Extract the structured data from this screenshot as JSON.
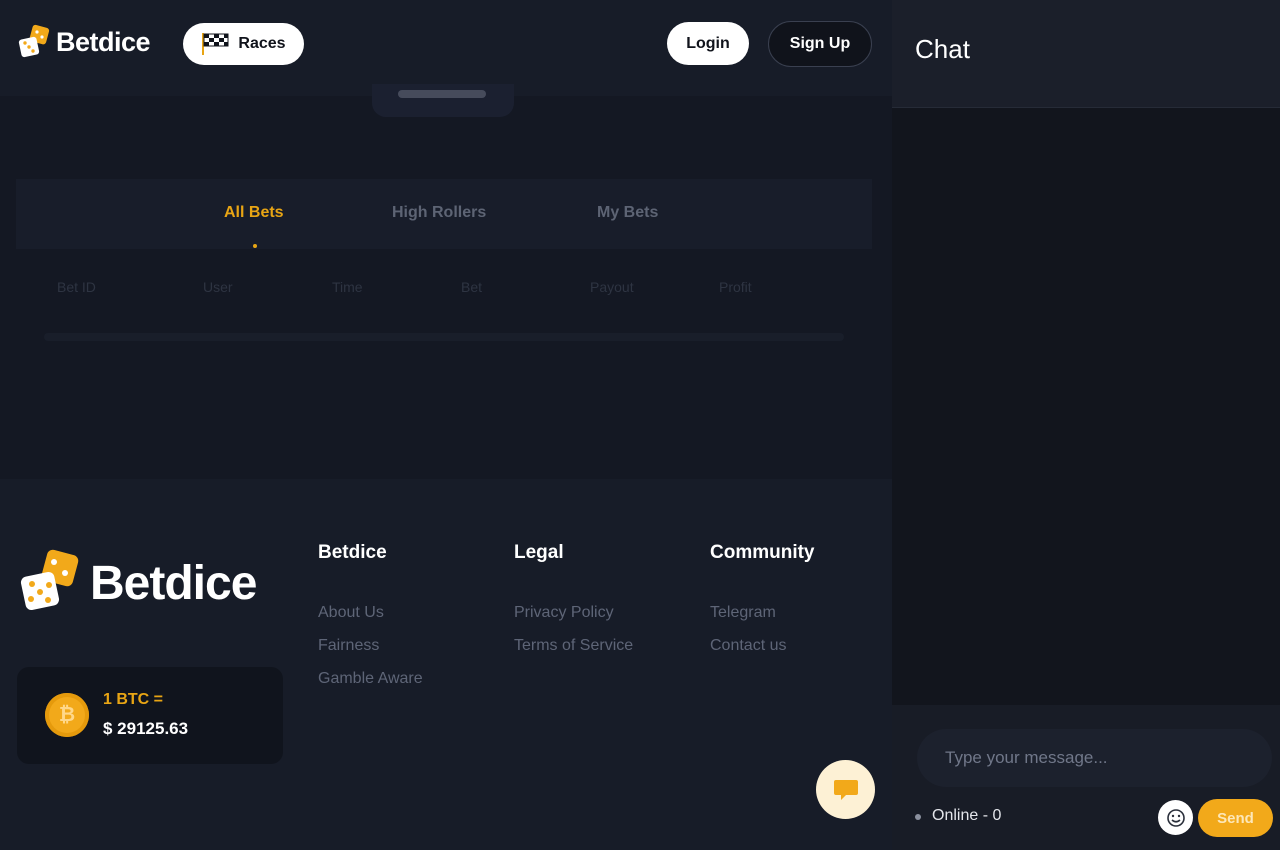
{
  "header": {
    "brand": "Betdice",
    "races_label": "Races",
    "login_label": "Login",
    "signup_label": "Sign Up"
  },
  "bets": {
    "tabs": [
      {
        "label": "All Bets",
        "active": true
      },
      {
        "label": "High Rollers",
        "active": false
      },
      {
        "label": "My Bets",
        "active": false
      }
    ],
    "columns": [
      "Bet ID",
      "User",
      "Time",
      "Bet",
      "Payout",
      "Profit"
    ]
  },
  "footer": {
    "brand": "Betdice",
    "btc": {
      "label": "1 BTC =",
      "value": "$ 29125.63"
    },
    "columns": [
      {
        "title": "Betdice",
        "links": [
          "About Us",
          "Fairness",
          "Gamble Aware"
        ]
      },
      {
        "title": "Legal",
        "links": [
          "Privacy Policy",
          "Terms of Service"
        ]
      },
      {
        "title": "Community",
        "links": [
          "Telegram",
          "Contact us"
        ]
      }
    ]
  },
  "chat": {
    "title": "Chat",
    "input_placeholder": "Type your message...",
    "online_label": "Online - 0",
    "send_label": "Send"
  },
  "colors": {
    "accent": "#f2a91a",
    "active_tab": "#e8a514",
    "background": "#141823",
    "panel": "#171c28"
  },
  "icons": [
    "dice-logo-icon",
    "checkered-flag-icon",
    "bitcoin-icon",
    "chat-bubble-icon",
    "emoji-icon"
  ]
}
